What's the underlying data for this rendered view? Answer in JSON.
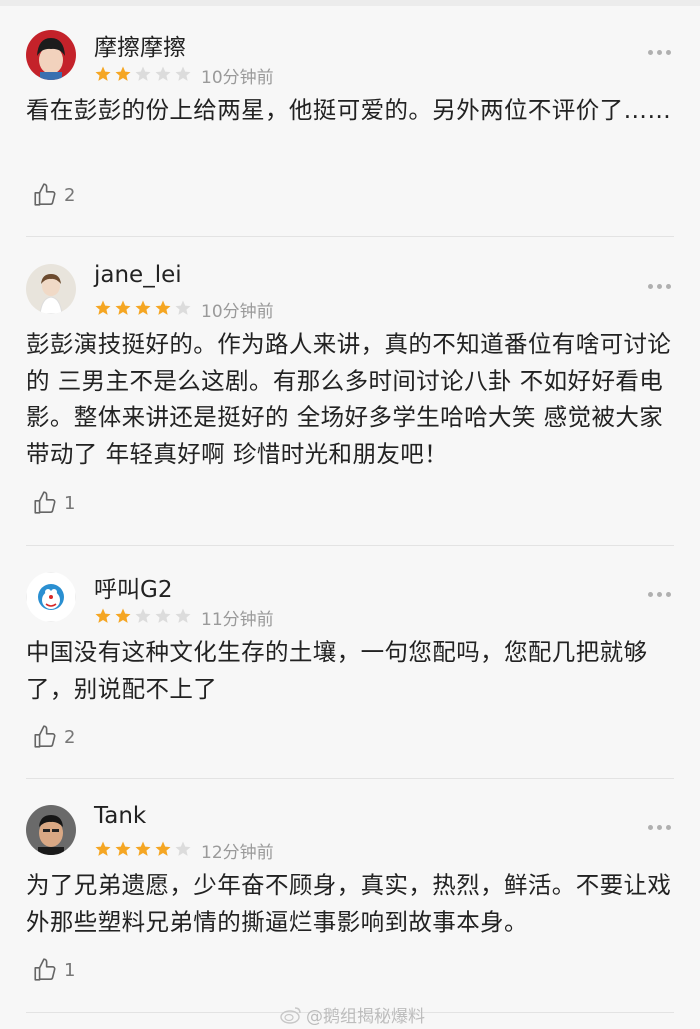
{
  "reviews": [
    {
      "username": "摩擦摩擦",
      "rating": 2,
      "max_rating": 5,
      "time": "10分钟前",
      "text": "看在彭彭的份上给两星，他挺可爱的。另外两位不评价了……",
      "likes": "2"
    },
    {
      "username": "jane_lei",
      "rating": 4,
      "max_rating": 5,
      "time": "10分钟前",
      "text": "彭彭演技挺好的。作为路人来讲，真的不知道番位有啥可讨论的 三男主不是么这剧。有那么多时间讨论八卦 不如好好看电影。整体来讲还是挺好的 全场好多学生哈哈大笑 感觉被大家带动了 年轻真好啊 珍惜时光和朋友吧！",
      "likes": "1"
    },
    {
      "username": "呼叫G2",
      "rating": 2,
      "max_rating": 5,
      "time": "11分钟前",
      "text": "中国没有这种文化生存的土壤，一句您配吗，您配几把就够了，别说配不上了",
      "likes": "2"
    },
    {
      "username": "Tank",
      "rating": 4,
      "max_rating": 5,
      "time": "12分钟前",
      "text": "为了兄弟遗愿，少年奋不顾身，真实，热烈，鲜活。不要让戏外那些塑料兄弟情的撕逼烂事影响到故事本身。",
      "likes": "1"
    }
  ],
  "colors": {
    "star_filled": "#f5a623",
    "star_empty": "#dcdcdc"
  },
  "icons": {
    "more": "more-options-icon",
    "like": "thumbs-up-icon"
  },
  "watermark": "@鹅组揭秘爆料"
}
